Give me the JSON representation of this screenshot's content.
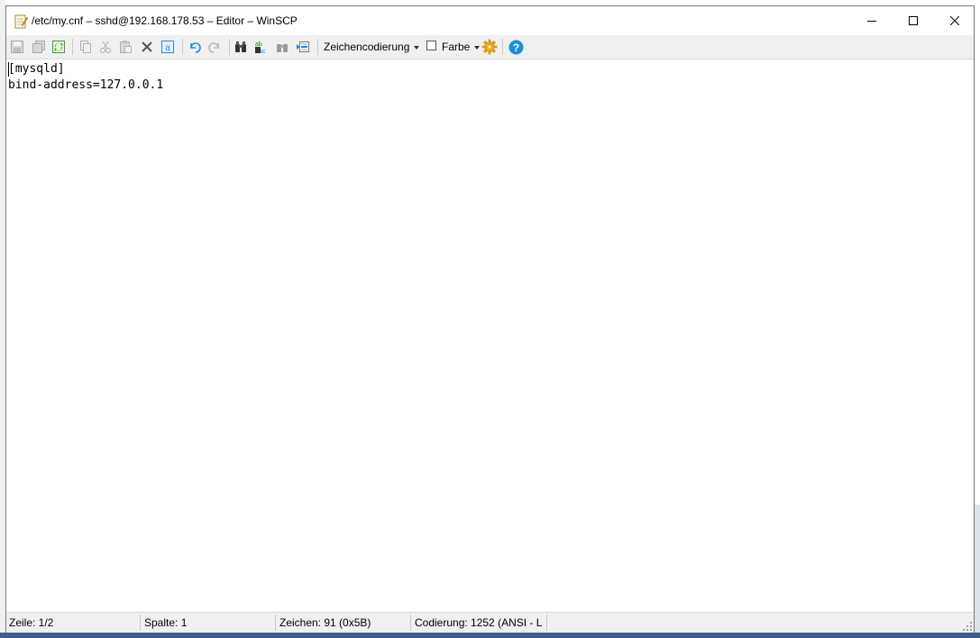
{
  "window": {
    "title": "/etc/my.cnf – sshd@192.168.178.53 – Editor – WinSCP"
  },
  "toolbar": {
    "encoding_label": "Zeichencodierung",
    "color_label": "Farbe",
    "color_checked": false,
    "icons": [
      "save-icon",
      "save-all-icon",
      "reload-icon",
      "copy-icon",
      "cut-icon",
      "paste-icon",
      "delete-icon",
      "select-all-icon",
      "undo-icon",
      "redo-icon",
      "find-icon",
      "replace-icon",
      "find-next-icon",
      "goto-line-icon",
      "preferences-icon",
      "help-icon"
    ]
  },
  "editor": {
    "lines": [
      "[mysqld]",
      "bind-address=127.0.0.1"
    ]
  },
  "status": {
    "line": "Zeile: 1/2",
    "column": "Spalte: 1",
    "char": "Zeichen: 91 (0x5B)",
    "encoding": "Codierung: 1252  (ANSI - L"
  },
  "colors": {
    "accent_blue": "#1e88e5",
    "help_blue": "#1c8fd8",
    "gear_orange": "#f5b21b"
  }
}
